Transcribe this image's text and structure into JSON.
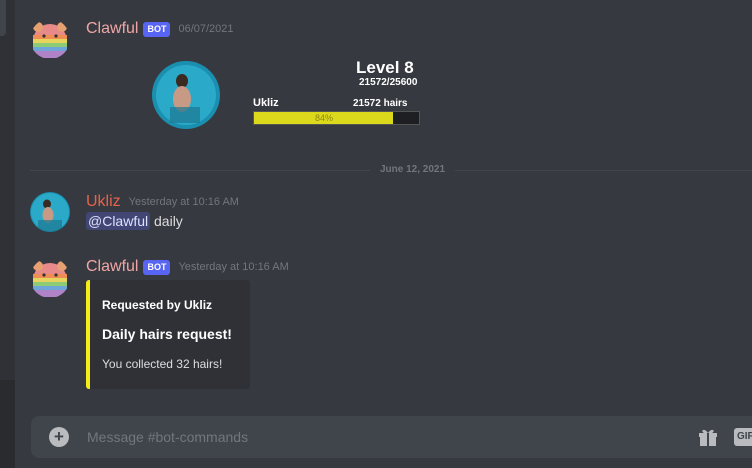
{
  "messages": [
    {
      "username": "Clawful",
      "bot_tag": "BOT",
      "timestamp": "06/07/2021",
      "avatar_icon": "rainbow-hamster-icon",
      "level_card": {
        "title": "Level 8",
        "xp": "21572/25600",
        "name": "Ukliz",
        "hairs": "21572 hairs",
        "percent_label": "84%",
        "progress": 0.84,
        "bar_color": "#dcd81c"
      }
    },
    {
      "username": "Ukliz",
      "timestamp": "Yesterday at 10:16 AM",
      "avatar_icon": "underwater-photo-icon",
      "mention": "@Clawful",
      "text": " daily"
    },
    {
      "username": "Clawful",
      "bot_tag": "BOT",
      "timestamp": "Yesterday at 10:16 AM",
      "avatar_icon": "rainbow-hamster-icon",
      "embed": {
        "author": "Requested by Ukliz",
        "title": "Daily hairs request!",
        "description": "You collected 32 hairs!",
        "accent_color": "#f4ed18"
      }
    }
  ],
  "divider": {
    "label": "June 12, 2021"
  },
  "composer": {
    "placeholder": "Message #bot-commands",
    "gif_label": "GIF"
  },
  "colors": {
    "background": "#36393f",
    "bot_username": "#f1a6a6",
    "user_username": "#e8624a",
    "bot_tag": "#5865f2"
  }
}
